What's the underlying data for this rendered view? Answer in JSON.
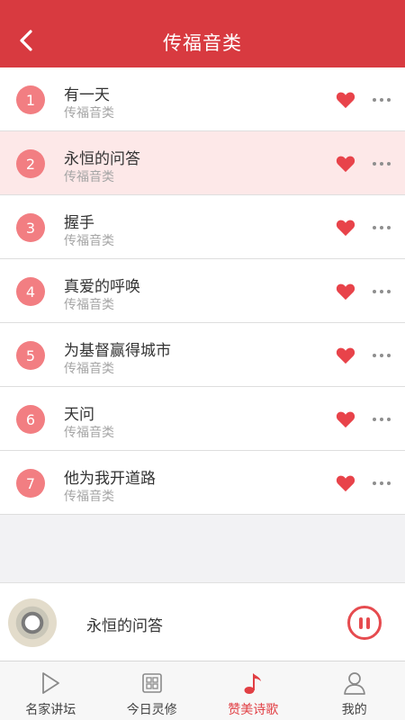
{
  "header": {
    "title": "传福音类",
    "back_icon": "back-chevron-icon"
  },
  "songs": [
    {
      "number": "1",
      "title": "有一天",
      "subtitle": "传福音类",
      "active": false
    },
    {
      "number": "2",
      "title": "永恒的问答",
      "subtitle": "传福音类",
      "active": true
    },
    {
      "number": "3",
      "title": "握手",
      "subtitle": "传福音类",
      "active": false
    },
    {
      "number": "4",
      "title": "真爱的呼唤",
      "subtitle": "传福音类",
      "active": false
    },
    {
      "number": "5",
      "title": "为基督赢得城市",
      "subtitle": "传福音类",
      "active": false
    },
    {
      "number": "6",
      "title": "天问",
      "subtitle": "传福音类",
      "active": false
    },
    {
      "number": "7",
      "title": "他为我开道路",
      "subtitle": "传福音类",
      "active": false
    }
  ],
  "player": {
    "title": "永恒的问答",
    "state_icon": "pause-icon"
  },
  "tabs": [
    {
      "label": "名家讲坛",
      "icon": "play-icon",
      "active": false
    },
    {
      "label": "今日灵修",
      "icon": "grid-icon",
      "active": false
    },
    {
      "label": "赞美诗歌",
      "icon": "music-note-icon",
      "active": true
    },
    {
      "label": "我的",
      "icon": "user-icon",
      "active": false
    }
  ],
  "colors": {
    "brand": "#d83a40",
    "accent": "#e64b4f",
    "number_badge": "#f27e82",
    "active_row": "#fde8e8"
  }
}
